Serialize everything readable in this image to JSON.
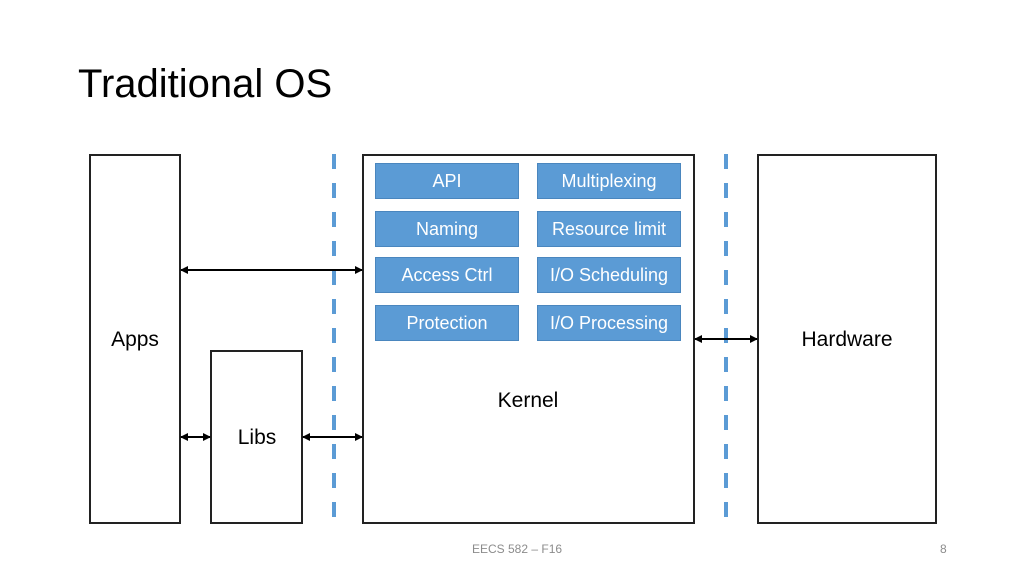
{
  "slide": {
    "title": "Traditional OS",
    "footer_text": "EECS 582 – F16",
    "page_number": "8"
  },
  "diagram": {
    "apps_label": "Apps",
    "libs_label": "Libs",
    "kernel_label": "Kernel",
    "hardware_label": "Hardware",
    "kernel_functions": [
      "API",
      "Multiplexing",
      "Naming",
      "Resource limit",
      "Access Ctrl",
      "I/O Scheduling",
      "Protection",
      "I/O Processing"
    ],
    "colors": {
      "function_fill": "#5b9bd5",
      "boundary_dash": "#5b9bd5",
      "outline": "#222222"
    }
  }
}
